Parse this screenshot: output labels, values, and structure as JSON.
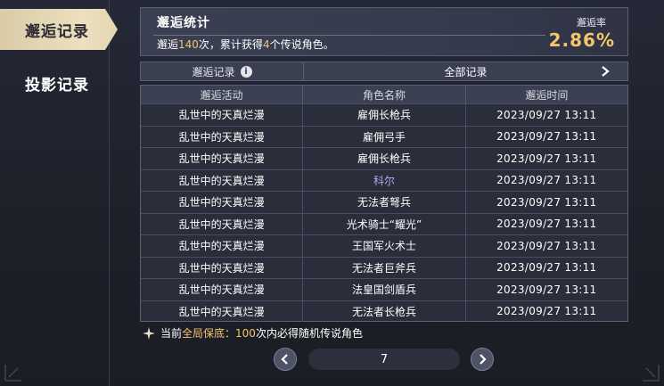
{
  "tabs": [
    {
      "label": "邂逅记录",
      "active": true
    },
    {
      "label": "投影记录",
      "active": false
    }
  ],
  "stats": {
    "title": "邂逅统计",
    "desc_prefix": "邂逅",
    "count": "140",
    "desc_mid": "次，累计获得",
    "legend_count": "4",
    "desc_suffix": "个传说角色。",
    "rate_label": "邂逅率",
    "rate_value": "2.86%"
  },
  "filter": {
    "label": "邂逅记录",
    "info_icon": "i",
    "selected": "全部记录"
  },
  "table": {
    "headers": [
      "邂逅活动",
      "角色名称",
      "邂逅时间"
    ],
    "rows": [
      {
        "event": "乱世中的天真烂漫",
        "name": "雇佣长枪兵",
        "time": "2023/09/27 13:11"
      },
      {
        "event": "乱世中的天真烂漫",
        "name": "雇佣弓手",
        "time": "2023/09/27 13:11"
      },
      {
        "event": "乱世中的天真烂漫",
        "name": "雇佣长枪兵",
        "time": "2023/09/27 13:11"
      },
      {
        "event": "乱世中的天真烂漫",
        "name": "科尔",
        "time": "2023/09/27 13:11"
      },
      {
        "event": "乱世中的天真烂漫",
        "name": "无法者弩兵",
        "time": "2023/09/27 13:11"
      },
      {
        "event": "乱世中的天真烂漫",
        "name": "光术骑士“耀光”",
        "time": "2023/09/27 13:11"
      },
      {
        "event": "乱世中的天真烂漫",
        "name": "王国军火术士",
        "time": "2023/09/27 13:11"
      },
      {
        "event": "乱世中的天真烂漫",
        "name": "无法者巨斧兵",
        "time": "2023/09/27 13:11"
      },
      {
        "event": "乱世中的天真烂漫",
        "name": "法皇国剑盾兵",
        "time": "2023/09/27 13:11"
      },
      {
        "event": "乱世中的天真烂漫",
        "name": "无法者长枪兵",
        "time": "2023/09/27 13:11"
      }
    ]
  },
  "guarantee": {
    "prefix": "当前",
    "highlight": "全局保底：",
    "count": "100",
    "suffix": "次内必得随机传说角色"
  },
  "pager": {
    "page": "7"
  },
  "colors": {
    "gold": "#f2c66d",
    "purple": "#b9a6f3",
    "tab_active": "#e3d6b1"
  }
}
